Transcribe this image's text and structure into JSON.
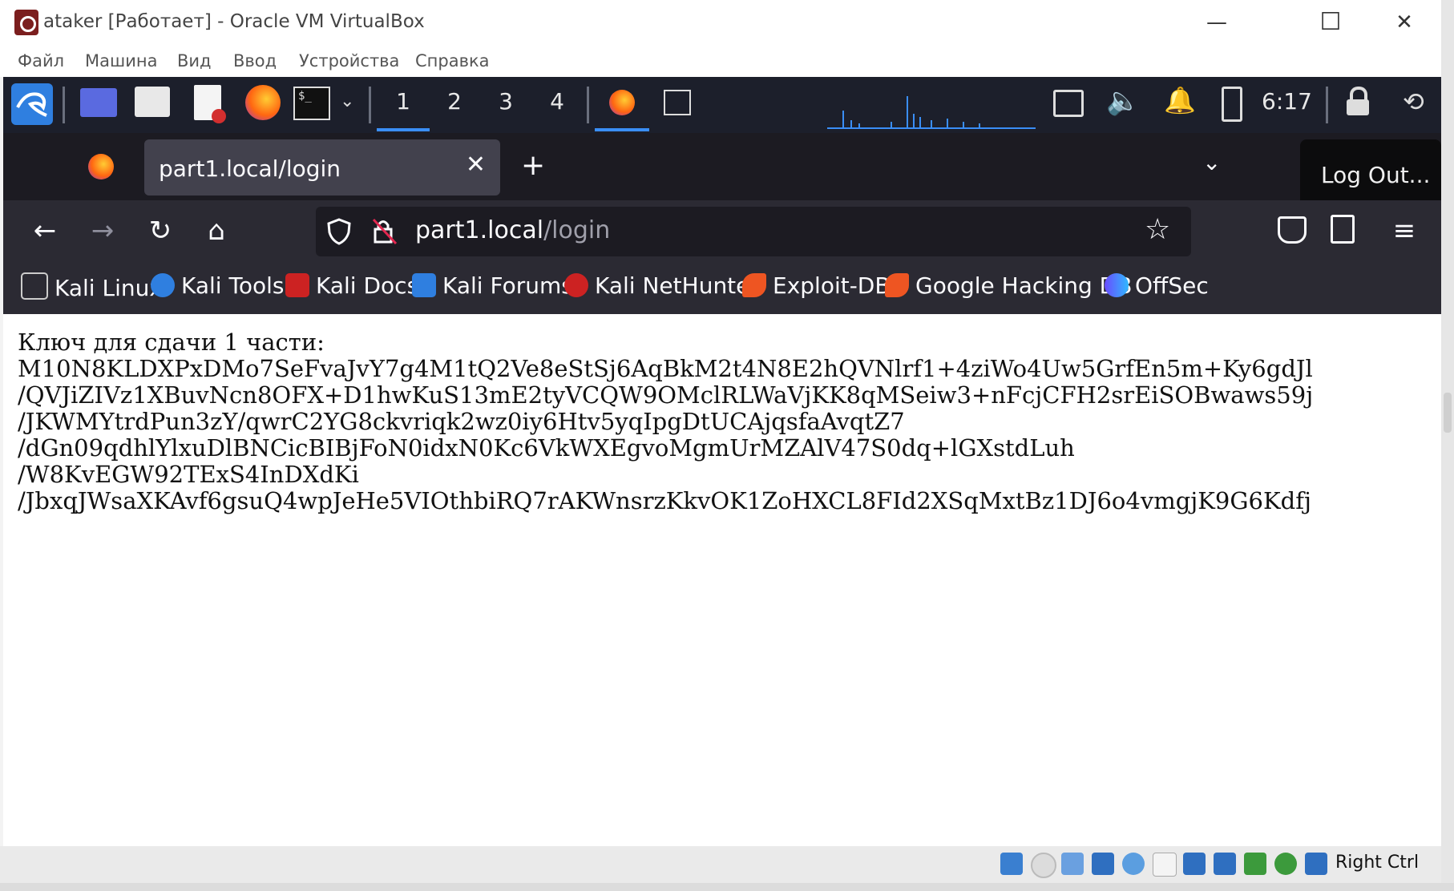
{
  "window": {
    "title": "ataker [Работает] - Oracle VM VirtualBox",
    "minimize_glyph": "—",
    "maximize_glyph": "☐",
    "close_glyph": "✕"
  },
  "menu": [
    "Файл",
    "Машина",
    "Вид",
    "Ввод",
    "Устройства",
    "Справка"
  ],
  "kali_panel": {
    "workspaces": [
      "1",
      "2",
      "3",
      "4"
    ],
    "active_workspace": "1",
    "clock": "6:17",
    "accent_color": "#3a8ef6"
  },
  "browser": {
    "tab_title": "part1.local/login",
    "tab_close_glyph": "✕",
    "new_tab_glyph": "+",
    "tab_list_glyph": "⌄",
    "tooltip": "Log Out...",
    "url_host": "part1.local",
    "url_path": "/login",
    "nav_icons": {
      "back": "←",
      "forward": "→",
      "reload": "↻",
      "home": "⌂",
      "bookmark_star": "☆",
      "menu": "≡"
    },
    "bookmarks": [
      {
        "label": "Kali Linux",
        "icon": "kali-dragon-icon"
      },
      {
        "label": "Kali Tools",
        "icon": "kali-tools-icon"
      },
      {
        "label": "Kali Docs",
        "icon": "kali-docs-icon"
      },
      {
        "label": "Kali Forums",
        "icon": "kali-forums-icon"
      },
      {
        "label": "Kali NetHunter",
        "icon": "nethunter-icon"
      },
      {
        "label": "Exploit-DB",
        "icon": "exploit-db-icon"
      },
      {
        "label": "Google Hacking DB",
        "icon": "ghdb-icon"
      },
      {
        "label": "OffSec",
        "icon": "offsec-icon"
      }
    ]
  },
  "page": {
    "lines": [
      "Ключ для сдачи 1 части:",
      "M10N8KLDXPxDMo7SeFvaJvY7g4M1tQ2Ve8eStSj6AqBkM2t4N8E2hQVNlrf1+4ziWo4Uw5GrfEn5m+Ky6gdJl",
      "/QVJiZIVz1XBuvNcn8OFX+D1hwKuS13mE2tyVCQW9OMclRLWaVjKK8qMSeiw3+nFcjCFH2srEiSOBwaws59j",
      "/JKWMYtrdPun3zY/qwrC2YG8ckvriqk2wz0iy6Htv5yqIpgDtUCAjqsfaAvqtZ7",
      "/dGn09qdhlYlxuDlBNCicBIBjFoN0idxN0Kc6VkWXEgvoMgmUrMZAlV47S0dq+lGXstdLuh",
      "/W8KvEGW92TExS4InDXdKi",
      "/JbxqJWsaXKAvf6gsuQ4wpJeHe5VIOthbiRQ7rAKWnsrzKkvOK1ZoHXCL8FId2XSqMxtBz1DJ6o4vmgjK9G6Kdfj"
    ]
  },
  "statusbar": {
    "host_key": "Right Ctrl"
  }
}
